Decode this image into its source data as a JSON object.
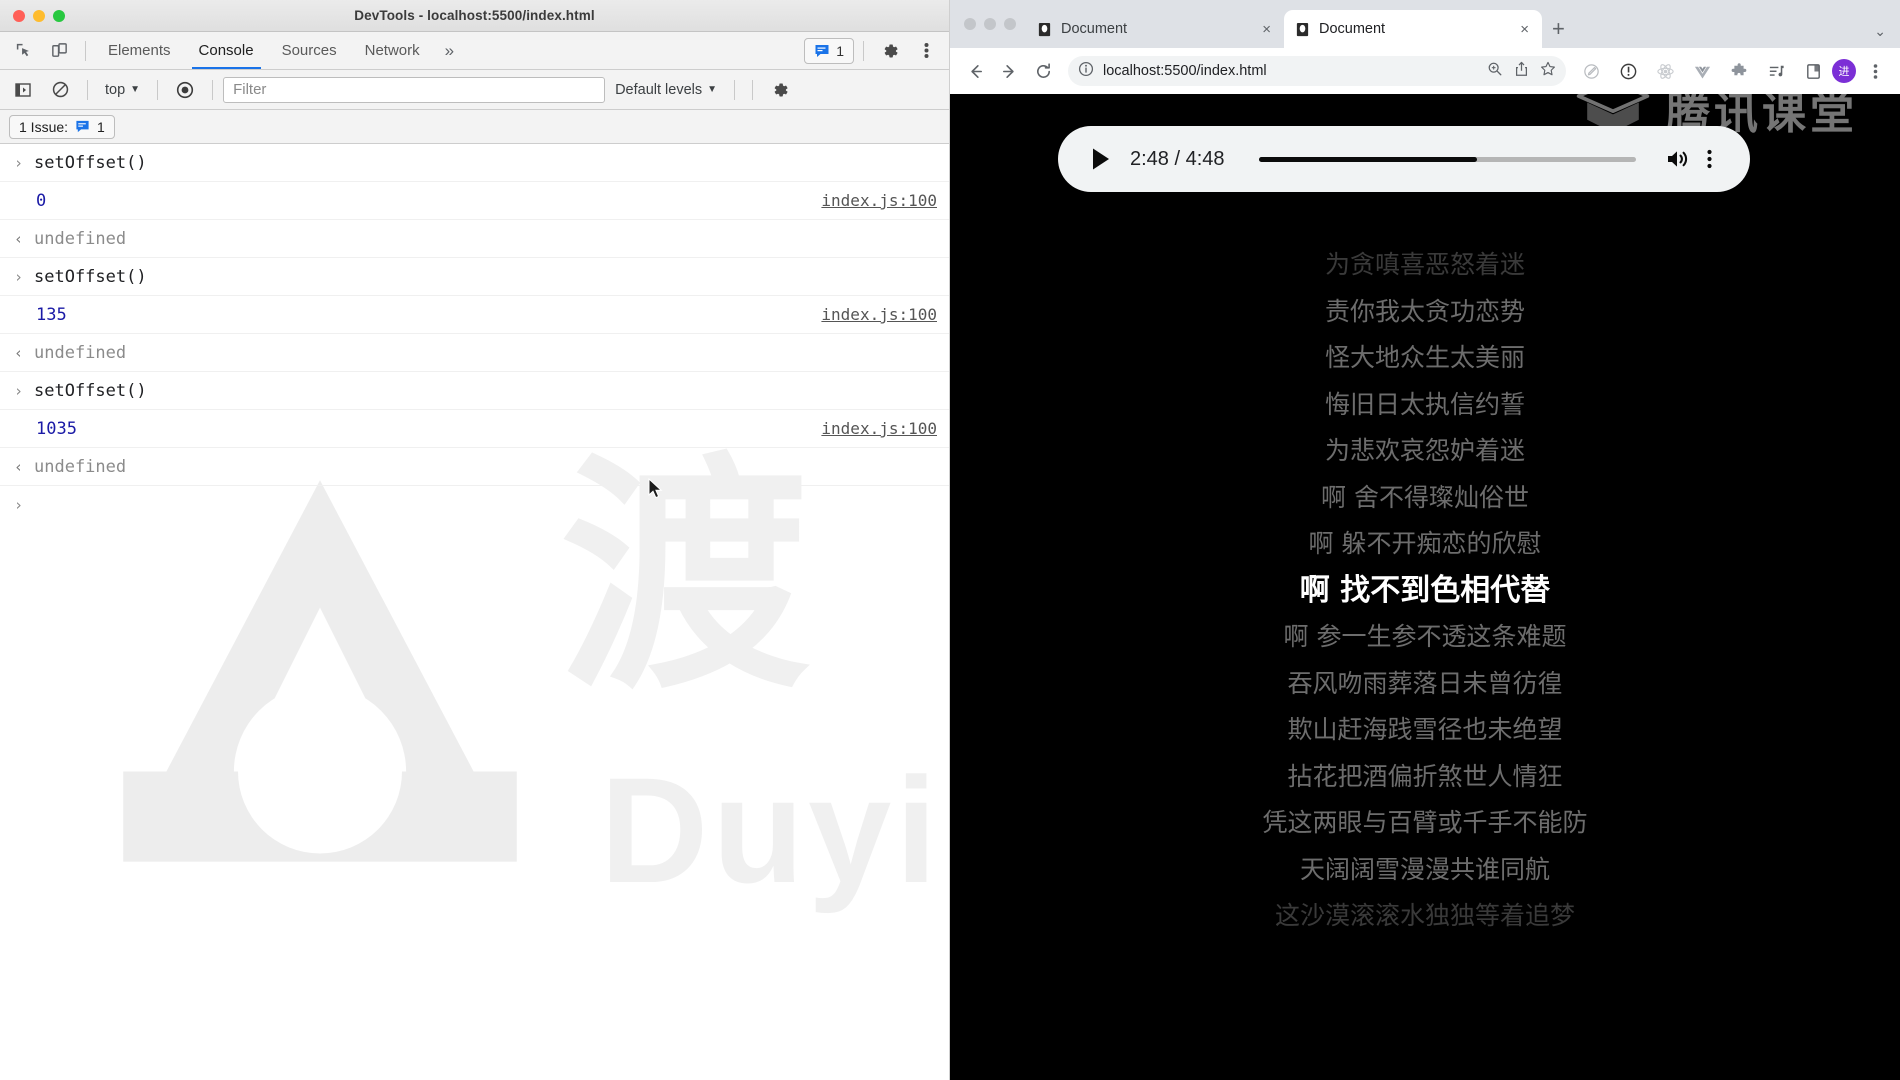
{
  "devtools": {
    "window_title": "DevTools - localhost:5500/index.html",
    "toolbar": {
      "inspect_icon": "inspect-element-icon",
      "device_icon": "device-toolbar-icon",
      "tabs": [
        {
          "label": "Elements",
          "active": false
        },
        {
          "label": "Console",
          "active": true
        },
        {
          "label": "Sources",
          "active": false
        },
        {
          "label": "Network",
          "active": false
        }
      ],
      "more_tabs": "»",
      "issues_count": "1",
      "settings_icon": "gear-icon",
      "menu_icon": "kebab-menu-icon"
    },
    "filterbar": {
      "sidebar_icon": "console-sidebar-icon",
      "clear_icon": "clear-console-icon",
      "context": "top",
      "eye_icon": "live-expression-icon",
      "filter_placeholder": "Filter",
      "filter_value": "",
      "levels": "Default levels",
      "settings_icon": "console-settings-gear-icon"
    },
    "issues_bar": {
      "label": "1 Issue:",
      "count": "1"
    },
    "console_rows": [
      {
        "type": "input",
        "marker": "›",
        "text": "setOffset()",
        "source": ""
      },
      {
        "type": "value",
        "marker": "",
        "text": "0",
        "source": "index.js:100"
      },
      {
        "type": "result",
        "marker": "‹",
        "text": "undefined",
        "source": ""
      },
      {
        "type": "input",
        "marker": "›",
        "text": "setOffset()",
        "source": ""
      },
      {
        "type": "value",
        "marker": "",
        "text": "135",
        "source": "index.js:100"
      },
      {
        "type": "result",
        "marker": "‹",
        "text": "undefined",
        "source": ""
      },
      {
        "type": "input",
        "marker": "›",
        "text": "setOffset()",
        "source": ""
      },
      {
        "type": "value",
        "marker": "",
        "text": "1035",
        "source": "index.js:100"
      },
      {
        "type": "result",
        "marker": "‹",
        "text": "undefined",
        "source": ""
      },
      {
        "type": "prompt",
        "marker": "›",
        "text": "",
        "source": ""
      }
    ],
    "watermark": {
      "logo": "duyi-logo-watermark",
      "text": "渡",
      "subtext": "Duyi"
    }
  },
  "browser": {
    "tabs": [
      {
        "label": "Document",
        "active": false,
        "favicon": "document-favicon",
        "close": "×"
      },
      {
        "label": "Document",
        "active": true,
        "favicon": "document-favicon",
        "close": "×"
      }
    ],
    "new_tab_icon": "new-tab-plus-icon",
    "tab_list_icon": "tab-search-chevron-icon",
    "nav": {
      "back_icon": "back-arrow-icon",
      "forward_icon": "forward-arrow-icon",
      "reload_icon": "reload-icon"
    },
    "omnibox": {
      "site_info_icon": "site-info-circle-icon",
      "url": "localhost:5500/index.html",
      "zoom_icon": "zoom-magnifier-icon",
      "share_icon": "share-icon",
      "bookmark_icon": "bookmark-star-icon"
    },
    "extensions": [
      {
        "name": "pen-annotation-icon"
      },
      {
        "name": "info-circle-icon"
      },
      {
        "name": "react-devtools-icon"
      },
      {
        "name": "vue-devtools-icon"
      },
      {
        "name": "extensions-puzzle-icon"
      },
      {
        "name": "media-list-icon"
      },
      {
        "name": "reading-list-icon"
      }
    ],
    "avatar_label": "进",
    "menu_icon": "browser-kebab-menu-icon"
  },
  "page": {
    "watermark": {
      "logo": "graduation-cap-icon",
      "text": "腾讯课堂"
    },
    "player": {
      "play_icon": "play-icon",
      "time": "2:48 / 4:48",
      "current_time": "2:48",
      "duration": "4:48",
      "progress_percent": 58,
      "volume_icon": "volume-high-icon",
      "menu_icon": "player-kebab-menu-icon"
    },
    "lyrics": [
      {
        "text": "为贪嗔喜恶怒着迷",
        "state": "clipped-top"
      },
      {
        "text": "责你我太贪功恋势",
        "state": "normal"
      },
      {
        "text": "怪大地众生太美丽",
        "state": "normal"
      },
      {
        "text": "悔旧日太执信约誓",
        "state": "normal"
      },
      {
        "text": "为悲欢哀怨妒着迷",
        "state": "normal"
      },
      {
        "text": "啊 舍不得璨灿俗世",
        "state": "normal"
      },
      {
        "text": "啊 躲不开痴恋的欣慰",
        "state": "normal"
      },
      {
        "text": "啊 找不到色相代替",
        "state": "active"
      },
      {
        "text": "啊 参一生参不透这条难题",
        "state": "normal"
      },
      {
        "text": "吞风吻雨葬落日未曾彷徨",
        "state": "normal"
      },
      {
        "text": "欺山赶海践雪径也未绝望",
        "state": "normal"
      },
      {
        "text": "拈花把酒偏折煞世人情狂",
        "state": "normal"
      },
      {
        "text": "凭这两眼与百臂或千手不能防",
        "state": "normal"
      },
      {
        "text": "天阔阔雪漫漫共谁同航",
        "state": "normal"
      },
      {
        "text": "这沙漠滚滚水独独等着追梦",
        "state": "clipped-bottom"
      }
    ]
  },
  "colors": {
    "accent_blue": "#1a73e8",
    "console_value": "#1a1aa6",
    "avatar_purple": "#7b2fd6",
    "page_bg": "#000000",
    "lyric_inactive": "#6d6d6d",
    "lyric_active": "#ffffff"
  }
}
